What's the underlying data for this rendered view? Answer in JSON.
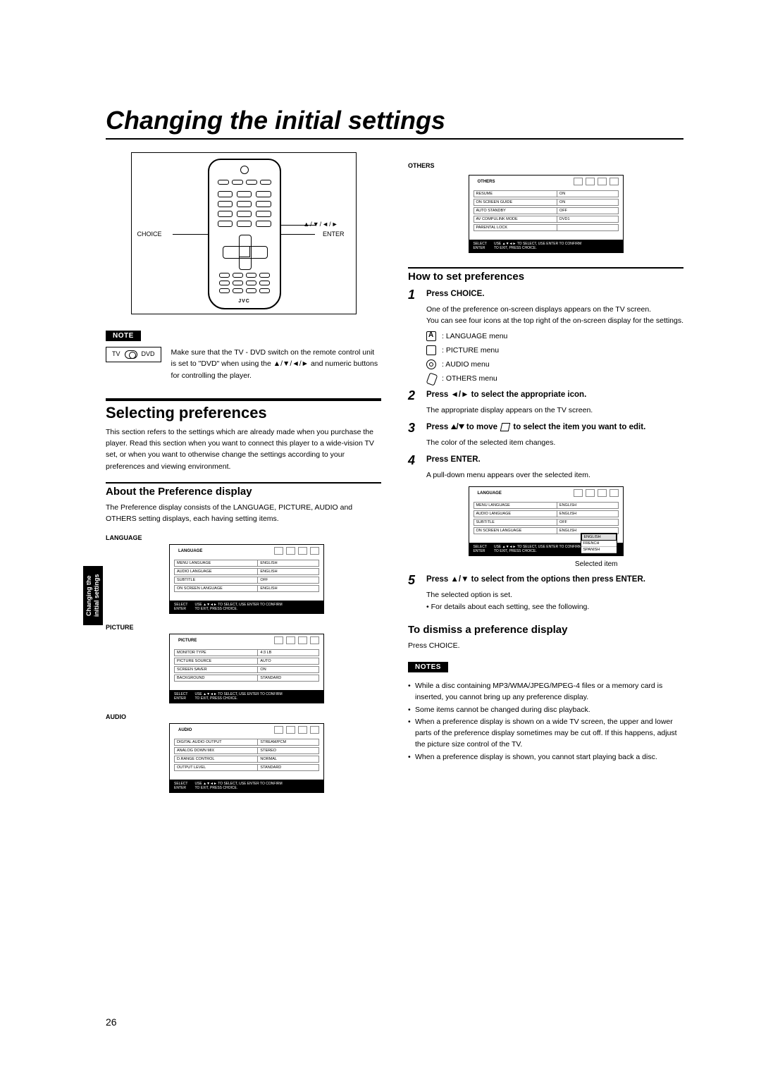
{
  "title": "Changing the initial settings",
  "page_number": "26",
  "side_tab": "Changing the\ninitial settings",
  "remote": {
    "choice": "CHOICE",
    "enter": "ENTER",
    "arrows": "▲/▼/◄/►",
    "brand": "JVC"
  },
  "note_badge": "NOTE",
  "switch": {
    "tv": "TV",
    "dvd": "DVD"
  },
  "note_text": "Make sure that the TV - DVD switch on the remote control unit is set to \"DVD\" when using the ▲/▼/◄/► and numeric buttons for controlling the player.",
  "selecting": {
    "heading": "Selecting preferences",
    "text": "This section refers to the settings which are already made when you purchase the player. Read this section when you want to connect this player to a wide-vision TV set, or when you want to otherwise change the settings according to your preferences and viewing environment."
  },
  "about": {
    "heading": "About the Preference display",
    "text": "The Preference display consists of the LANGUAGE, PICTURE, AUDIO and OTHERS setting displays, each having setting items."
  },
  "osd_labels": {
    "language": "LANGUAGE",
    "picture": "PICTURE",
    "audio": "AUDIO",
    "others": "OTHERS"
  },
  "osd_footer": {
    "select": "SELECT",
    "enter": "ENTER",
    "hint": "USE ▲▼◄► TO SELECT, USE ENTER TO CONFIRM\nTO EXIT, PRESS CHOICE."
  },
  "osd": {
    "language": [
      {
        "k": "MENU LANGUAGE",
        "v": "ENGLISH"
      },
      {
        "k": "AUDIO LANGUAGE",
        "v": "ENGLISH"
      },
      {
        "k": "SUBTITLE",
        "v": "OFF"
      },
      {
        "k": "ON SCREEN LANGUAGE",
        "v": "ENGLISH"
      }
    ],
    "picture": [
      {
        "k": "MONITOR TYPE",
        "v": "4:3 LB"
      },
      {
        "k": "PICTURE SOURCE",
        "v": "AUTO"
      },
      {
        "k": "SCREEN SAVER",
        "v": "ON"
      },
      {
        "k": "BACKGROUND",
        "v": "STANDARD"
      }
    ],
    "audio": [
      {
        "k": "DIGITAL AUDIO OUTPUT",
        "v": "STREAM/PCM"
      },
      {
        "k": "ANALOG DOWN MIX",
        "v": "STEREO"
      },
      {
        "k": "D.RANGE CONTROL",
        "v": "NORMAL"
      },
      {
        "k": "OUTPUT LEVEL",
        "v": "STANDARD"
      }
    ],
    "others": [
      {
        "k": "RESUME",
        "v": "ON"
      },
      {
        "k": "ON SCREEN GUIDE",
        "v": "ON"
      },
      {
        "k": "AUTO STANDBY",
        "v": "OFF"
      },
      {
        "k": "AV COMPULINK MODE",
        "v": "DVD1"
      },
      {
        "k": "PARENTAL LOCK",
        "v": ""
      }
    ],
    "dropdown": [
      "ENGLISH",
      "FRENCH",
      "SPANISH"
    ]
  },
  "howto": {
    "heading": "How to set preferences",
    "steps": [
      {
        "num": "1",
        "head": "Press CHOICE.",
        "body": "One of the preference on-screen displays appears on the TV screen.\nYou can see four icons at the top right of the on-screen display for the settings."
      },
      {
        "num": "2",
        "head": "Press ◄/► to select the appropriate icon.",
        "body": "The appropriate display appears on the TV screen."
      },
      {
        "num": "3",
        "head": "Press ▲/▼ to move  ▢  to select the item you want to edit.",
        "body": "The color of the selected item changes."
      },
      {
        "num": "4",
        "head": "Press ENTER.",
        "body": "A pull-down menu appears over the selected item."
      },
      {
        "num": "5",
        "head": "Press ▲/▼ to select from the options then press ENTER.",
        "body": "The selected option is set.\n• For details about each setting, see the following."
      }
    ],
    "menus": [
      {
        "icon": "lang",
        "label": ": LANGUAGE menu"
      },
      {
        "icon": "pic",
        "label": ": PICTURE menu"
      },
      {
        "icon": "aud",
        "label": ": AUDIO menu"
      },
      {
        "icon": "oth",
        "label": ": OTHERS menu"
      }
    ],
    "selected_item": "Selected item"
  },
  "dismiss": {
    "heading": "To dismiss a preference display",
    "text": "Press CHOICE."
  },
  "notes_badge": "NOTES",
  "notes": [
    "While a disc containing MP3/WMA/JPEG/MPEG-4 files or a memory card is inserted, you cannot bring up any preference display.",
    "Some items cannot be changed during disc playback.",
    "When a preference display is shown on a wide TV screen, the upper and lower parts of the preference display sometimes may be cut off. If this happens, adjust the picture size control of the TV.",
    "When a preference display is shown, you cannot start playing back a disc."
  ]
}
